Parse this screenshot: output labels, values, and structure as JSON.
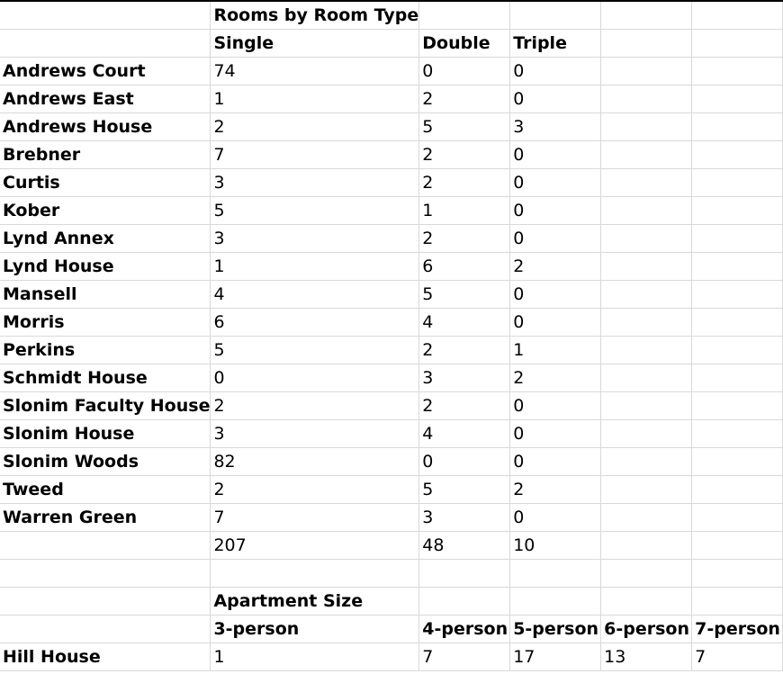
{
  "room_table": {
    "title": "Rooms by Room Type",
    "headers": [
      "Single",
      "Double",
      "Triple"
    ],
    "rows": [
      {
        "name": "Andrews Court",
        "values": [
          "74",
          "0",
          "0"
        ]
      },
      {
        "name": "Andrews East",
        "values": [
          "1",
          "2",
          "0"
        ]
      },
      {
        "name": "Andrews House",
        "values": [
          "2",
          "5",
          "3"
        ]
      },
      {
        "name": "Brebner",
        "values": [
          "7",
          "2",
          "0"
        ]
      },
      {
        "name": "Curtis",
        "values": [
          "3",
          "2",
          "0"
        ]
      },
      {
        "name": "Kober",
        "values": [
          "5",
          "1",
          "0"
        ]
      },
      {
        "name": "Lynd Annex",
        "values": [
          "3",
          "2",
          "0"
        ]
      },
      {
        "name": "Lynd House",
        "values": [
          "1",
          "6",
          "2"
        ]
      },
      {
        "name": "Mansell",
        "values": [
          "4",
          "5",
          "0"
        ]
      },
      {
        "name": "Morris",
        "values": [
          "6",
          "4",
          "0"
        ]
      },
      {
        "name": "Perkins",
        "values": [
          "5",
          "2",
          "1"
        ]
      },
      {
        "name": "Schmidt House",
        "values": [
          "0",
          "3",
          "2"
        ]
      },
      {
        "name": "Slonim Faculty House",
        "values": [
          "2",
          "2",
          "0"
        ]
      },
      {
        "name": "Slonim House",
        "values": [
          "3",
          "4",
          "0"
        ]
      },
      {
        "name": "Slonim Woods",
        "values": [
          "82",
          "0",
          "0"
        ]
      },
      {
        "name": "Tweed",
        "values": [
          "2",
          "5",
          "2"
        ]
      },
      {
        "name": "Warren Green",
        "values": [
          "7",
          "3",
          "0"
        ]
      }
    ],
    "totals": [
      "207",
      "48",
      "10"
    ]
  },
  "apartment_table": {
    "title": "Apartment Size",
    "headers": [
      "3-person",
      "4-person",
      "5-person",
      "6-person",
      "7-person"
    ],
    "rows": [
      {
        "name": "Hill House",
        "values": [
          "1",
          "7",
          "17",
          "13",
          "7"
        ]
      }
    ]
  }
}
